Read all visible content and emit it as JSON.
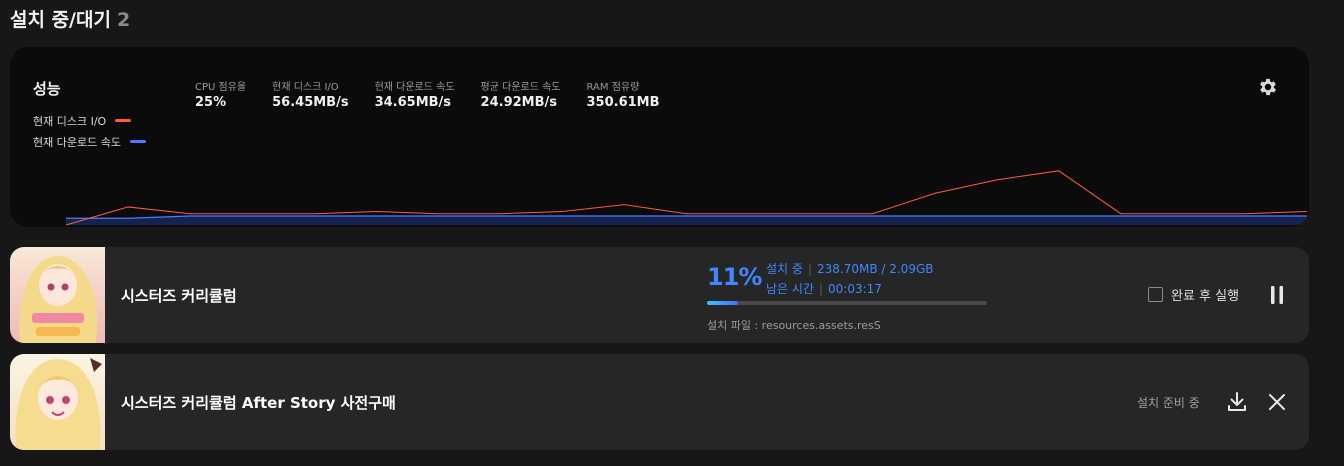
{
  "header": {
    "title": "설치 중/대기",
    "count": "2"
  },
  "performance": {
    "title": "성능",
    "legend": [
      {
        "label": "현재 디스크 I/O",
        "color": "#ff5a3c"
      },
      {
        "label": "현재 다운로드 속도",
        "color": "#4a7bff"
      }
    ],
    "stats": [
      {
        "label": "CPU 점유율",
        "value": "25%"
      },
      {
        "label": "현재 디스크 I/O",
        "value": "56.45MB/s"
      },
      {
        "label": "현재 다운로드 속도",
        "value": "34.65MB/s"
      },
      {
        "label": "평균 다운로드 속도",
        "value": "24.92MB/s"
      },
      {
        "label": "RAM 점유량",
        "value": "350.61MB"
      }
    ],
    "settings_icon": "gear-icon"
  },
  "chart_data": {
    "type": "line",
    "title": "",
    "xlabel": "",
    "ylabel": "",
    "ylim": [
      0,
      70
    ],
    "series": [
      {
        "name": "현재 디스크 I/O",
        "color": "#ff5a3c",
        "values": [
          0,
          8,
          5,
          5,
          5,
          6,
          5,
          5,
          6,
          9,
          5,
          5,
          5,
          5,
          14,
          20,
          24,
          5,
          5,
          5,
          6
        ]
      },
      {
        "name": "현재 다운로드 속도",
        "color": "#4a7bff",
        "values": [
          3,
          3,
          4,
          4,
          4,
          4,
          4,
          4,
          4,
          4,
          4,
          4,
          4,
          4,
          4,
          4,
          4,
          4,
          4,
          4,
          4
        ]
      }
    ]
  },
  "items": [
    {
      "title": "시스터즈 커리큘럼",
      "percent": "11%",
      "status_label": "설치 중",
      "size": "238.70MB / 2.09GB",
      "remaining_label": "남은 시간",
      "remaining": "00:03:17",
      "progress": 0.11,
      "file": "설치 파일 : resources.assets.resS",
      "run_after_label": "완료 후 실행",
      "action_icon": "pause-icon"
    },
    {
      "title": "시스터즈 커리큘럼 After Story 사전구매",
      "status": "설치 준비 중",
      "action_icons": [
        "download-icon",
        "close-icon"
      ]
    }
  ]
}
